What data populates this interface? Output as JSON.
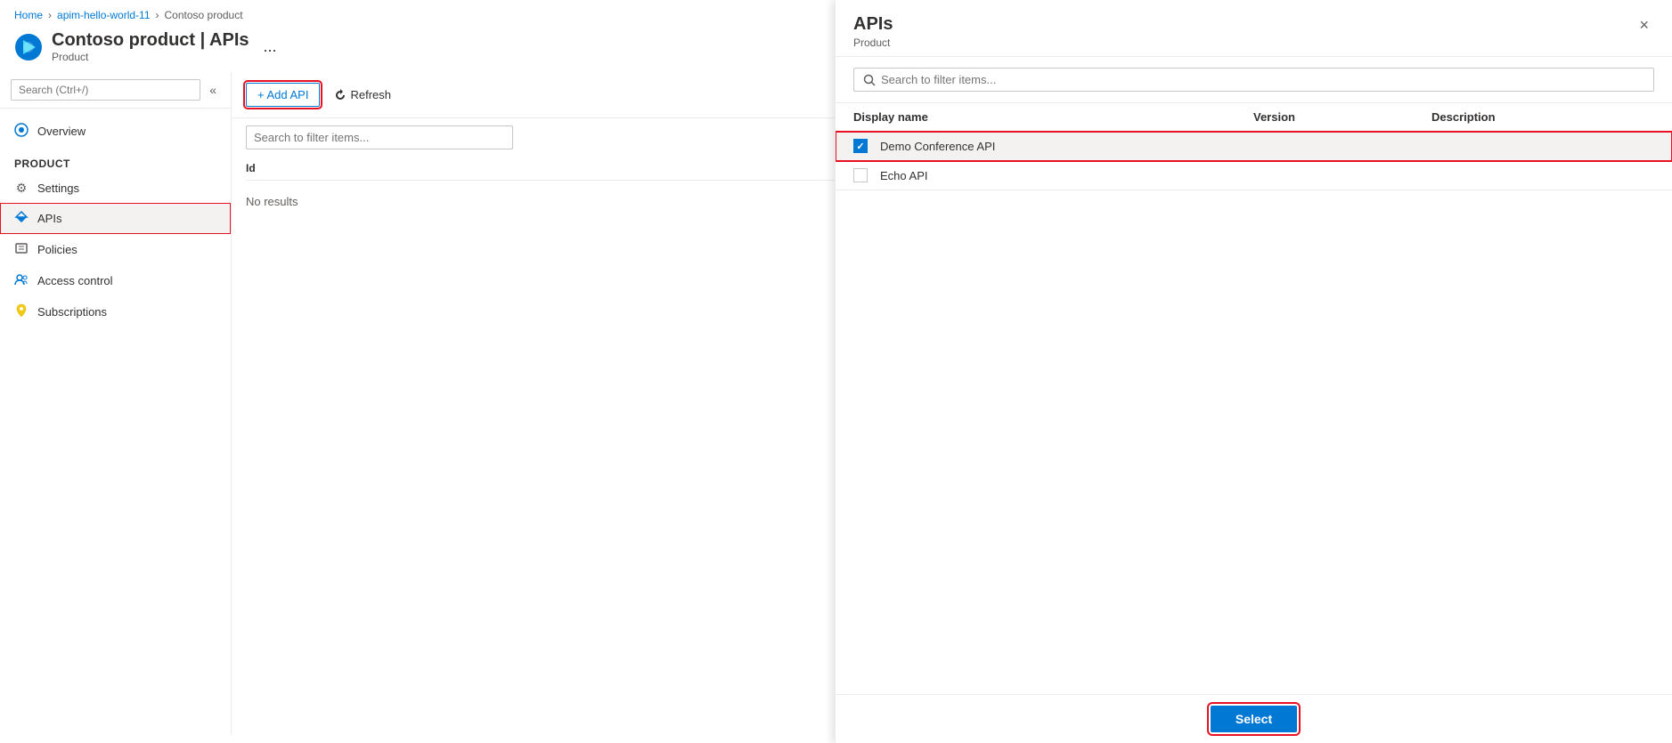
{
  "breadcrumb": {
    "home": "Home",
    "apim": "apim-hello-world-11",
    "current": "Contoso product"
  },
  "header": {
    "title": "Contoso product | APIs",
    "subtitle": "Product",
    "more_label": "..."
  },
  "sidebar": {
    "search_placeholder": "Search (Ctrl+/)",
    "collapse_icon": "«",
    "nav_items": [
      {
        "id": "overview",
        "label": "Overview",
        "icon": "○"
      }
    ],
    "section_label": "Product",
    "section_items": [
      {
        "id": "settings",
        "label": "Settings",
        "icon": "⚙"
      },
      {
        "id": "apis",
        "label": "APIs",
        "icon": "→",
        "active": true
      },
      {
        "id": "policies",
        "label": "Policies",
        "icon": "≡"
      },
      {
        "id": "access-control",
        "label": "Access control",
        "icon": "👥"
      },
      {
        "id": "subscriptions",
        "label": "Subscriptions",
        "icon": "🔑"
      }
    ]
  },
  "toolbar": {
    "add_api_label": "+ Add API",
    "refresh_label": "Refresh"
  },
  "main_table": {
    "search_placeholder": "Search to filter items...",
    "col_id": "Id",
    "no_results": "No results"
  },
  "panel": {
    "title": "APIs",
    "subtitle": "Product",
    "close_label": "×",
    "search_placeholder": "Search to filter items...",
    "columns": {
      "display_name": "Display name",
      "version": "Version",
      "description": "Description"
    },
    "apis": [
      {
        "id": "demo",
        "name": "Demo Conference API",
        "version": "",
        "description": "",
        "checked": true
      },
      {
        "id": "echo",
        "name": "Echo API",
        "version": "",
        "description": "",
        "checked": false
      }
    ],
    "select_label": "Select"
  }
}
